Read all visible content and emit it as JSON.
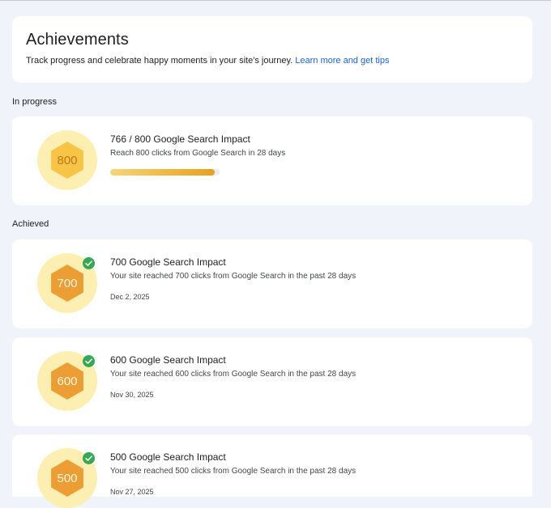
{
  "header": {
    "title": "Achievements",
    "description": "Track progress and celebrate happy moments in your site's journey. ",
    "link_label": "Learn more and get tips"
  },
  "sections": {
    "in_progress_label": "In progress",
    "achieved_label": "Achieved"
  },
  "in_progress": {
    "badge_number": "800",
    "title": "766 / 800 Google Search Impact",
    "description": "Reach 800 clicks from Google Search in 28 days",
    "progress_fraction": 0.9575
  },
  "achieved": [
    {
      "badge_number": "700",
      "title": "700 Google Search Impact",
      "description": "Your site reached 700 clicks from Google Search in the past 28 days",
      "date": "Dec 2, 2025"
    },
    {
      "badge_number": "600",
      "title": "600 Google Search Impact",
      "description": "Your site reached 600 clicks from Google Search in the past 28 days",
      "date": "Nov 30, 2025"
    },
    {
      "badge_number": "500",
      "title": "500 Google Search Impact",
      "description": "Your site reached 500 clicks from Google Search in the past 28 days",
      "date": "Nov 27, 2025"
    }
  ],
  "colors": {
    "page_bg": "#f1f3fa",
    "card_bg": "#ffffff",
    "link": "#1a63d6",
    "badge_halo": "#fdeeb2",
    "badge_hex_progress": "#f7c446",
    "badge_hex_achieved": "#ec9d33",
    "check_green": "#34a853"
  },
  "icons": {
    "badge": "hexagon-badge-icon",
    "check": "check-circle-icon"
  }
}
